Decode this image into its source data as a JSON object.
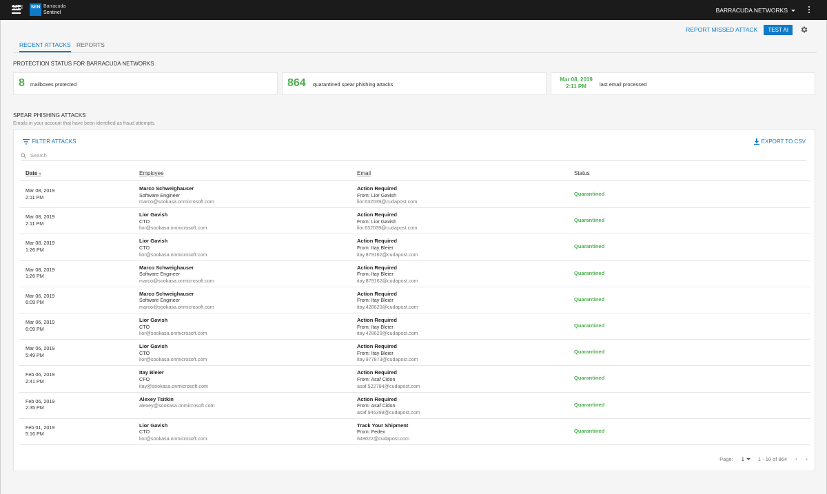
{
  "topbar": {
    "app_label": "MEI",
    "logo_text": "SEN",
    "brand_line1": "Barracuda",
    "brand_line2": "Sentinel",
    "org_name": "BARRACUDA NETWORKS"
  },
  "actions": {
    "report_missed": "REPORT MISSED ATTACK",
    "test_ai": "TEST AI"
  },
  "tabs": [
    {
      "label": "RECENT ATTACKS",
      "active": true
    },
    {
      "label": "REPORTS",
      "active": false
    }
  ],
  "protection": {
    "title": "PROTECTION STATUS FOR BARRACUDA NETWORKS",
    "stats": [
      {
        "value": "8",
        "label": "mailboxes protected"
      },
      {
        "value": "864",
        "label": "quarantined spear phishing attacks"
      },
      {
        "value_line1": "Mar 08, 2019",
        "value_line2": "2:11 PM",
        "label": "last email processed"
      }
    ]
  },
  "attacks": {
    "title": "SPEAR PHISHING ATTACKS",
    "subtitle": "Emails in your account that have been identified as fraud attempts.",
    "filter_label": "FILTER ATTACKS",
    "export_label": "EXPORT TO CSV",
    "search_placeholder": "Search",
    "columns": {
      "date": "Date",
      "employee": "Employee",
      "email": "Email",
      "status": "Status"
    },
    "rows": [
      {
        "date": "Mar 08, 2019",
        "time": "2:11 PM",
        "emp_name": "Marco Schweighauser",
        "emp_title": "Software Engineer",
        "emp_email": "marco@sookasa.onmicrosoft.com",
        "subject": "Action Required",
        "from": "From: Lior Gavish",
        "from_email": "lior.632039@cudapost.com",
        "status": "Quarantined"
      },
      {
        "date": "Mar 08, 2019",
        "time": "2:11 PM",
        "emp_name": "Lior Gavish",
        "emp_title": "CTO",
        "emp_email": "lior@sookasa.onmicrosoft.com",
        "subject": "Action Required",
        "from": "From: Lior Gavish",
        "from_email": "lior.632039@cudapost.com",
        "status": "Quarantined"
      },
      {
        "date": "Mar 08, 2019",
        "time": "1:26 PM",
        "emp_name": "Lior Gavish",
        "emp_title": "CTO",
        "emp_email": "lior@sookasa.onmicrosoft.com",
        "subject": "Action Required",
        "from": "From: Itay Bleier",
        "from_email": "itay.879162@cudapost.com",
        "status": "Quarantined"
      },
      {
        "date": "Mar 08, 2019",
        "time": "1:26 PM",
        "emp_name": "Marco Schweighauser",
        "emp_title": "Software Engineer",
        "emp_email": "marco@sookasa.onmicrosoft.com",
        "subject": "Action Required",
        "from": "From: Itay Bleier",
        "from_email": "itay.879162@cudapost.com",
        "status": "Quarantined"
      },
      {
        "date": "Mar 06, 2019",
        "time": "6:09 PM",
        "emp_name": "Marco Schweighauser",
        "emp_title": "Software Engineer",
        "emp_email": "marco@sookasa.onmicrosoft.com",
        "subject": "Action Required",
        "from": "From: Itay Bleier",
        "from_email": "itay.428620@cudapost.com",
        "status": "Quarantined"
      },
      {
        "date": "Mar 06, 2019",
        "time": "6:09 PM",
        "emp_name": "Lior Gavish",
        "emp_title": "CTO",
        "emp_email": "lior@sookasa.onmicrosoft.com",
        "subject": "Action Required",
        "from": "From: Itay Bleier",
        "from_email": "itay.428620@cudapost.com",
        "status": "Quarantined"
      },
      {
        "date": "Mar 06, 2019",
        "time": "5:49 PM",
        "emp_name": "Lior Gavish",
        "emp_title": "CTO",
        "emp_email": "lior@sookasa.onmicrosoft.com",
        "subject": "Action Required",
        "from": "From: Itay Bleier",
        "from_email": "itay.977873@cudapost.com",
        "status": "Quarantined"
      },
      {
        "date": "Feb 06, 2019",
        "time": "2:41 PM",
        "emp_name": "Itay Bleier",
        "emp_title": "CFO",
        "emp_email": "itay@sookasa.onmicrosoft.com",
        "subject": "Action Required",
        "from": "From: Asaf Cidon",
        "from_email": "asaf.522784@cudapost.com",
        "status": "Quarantined"
      },
      {
        "date": "Feb 06, 2019",
        "time": "2:35 PM",
        "emp_name": "Alexey Tsitkin",
        "emp_title": "",
        "emp_email": "alexey@sookasa.onmicrosoft.com",
        "subject": "Action Required",
        "from": "From: Asaf Cidon",
        "from_email": "asaf.946398@cudapost.com",
        "status": "Quarantined"
      },
      {
        "date": "Feb 01, 2019",
        "time": "5:16 PM",
        "emp_name": "Lior Gavish",
        "emp_title": "CTO",
        "emp_email": "lior@sookasa.onmicrosoft.com",
        "subject": "Track Your Shipment",
        "from": "From: Fedex",
        "from_email": "649022@cudapost.com",
        "status": "Quarantined"
      }
    ],
    "pager": {
      "label": "Page:",
      "page": "1",
      "range": "1 - 10 of 864",
      "prev": "‹",
      "next": "›"
    }
  },
  "colors": {
    "accent": "#0f7ac8",
    "success": "#4caf50",
    "topbar": "#1b1b1b"
  }
}
